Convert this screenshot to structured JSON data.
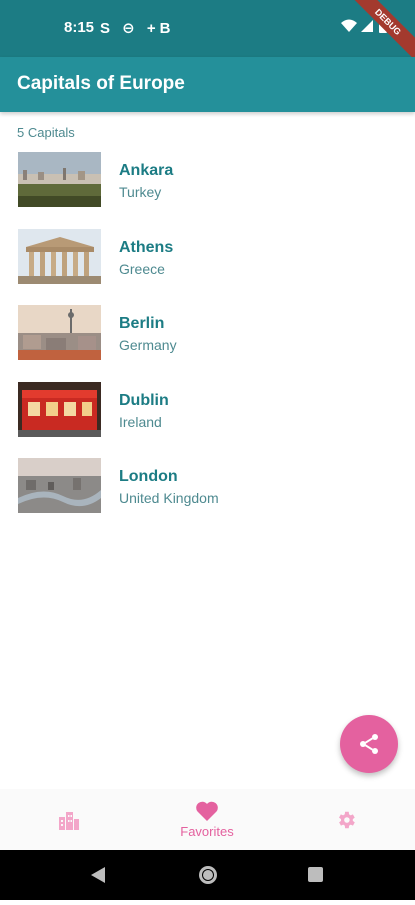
{
  "status_bar": {
    "time": "8:15",
    "left_icons": "S ⊖ +B",
    "debug_banner": "DEBUG"
  },
  "app_bar": {
    "title": "Capitals of Europe"
  },
  "list": {
    "count_label": "5 Capitals",
    "items": [
      {
        "name": "Ankara",
        "country": "Turkey"
      },
      {
        "name": "Athens",
        "country": "Greece"
      },
      {
        "name": "Berlin",
        "country": "Germany"
      },
      {
        "name": "Dublin",
        "country": "Ireland"
      },
      {
        "name": "London",
        "country": "United Kingdom"
      }
    ]
  },
  "fab": {
    "icon": "share-icon"
  },
  "bottom_nav": {
    "items": [
      {
        "icon": "city-icon",
        "label": ""
      },
      {
        "icon": "heart-icon",
        "label": "Favorites",
        "selected": true
      },
      {
        "icon": "gear-icon",
        "label": ""
      }
    ]
  },
  "colors": {
    "primary": "#24909a",
    "status_bar": "#1c7c84",
    "accent": "#e4619f"
  }
}
